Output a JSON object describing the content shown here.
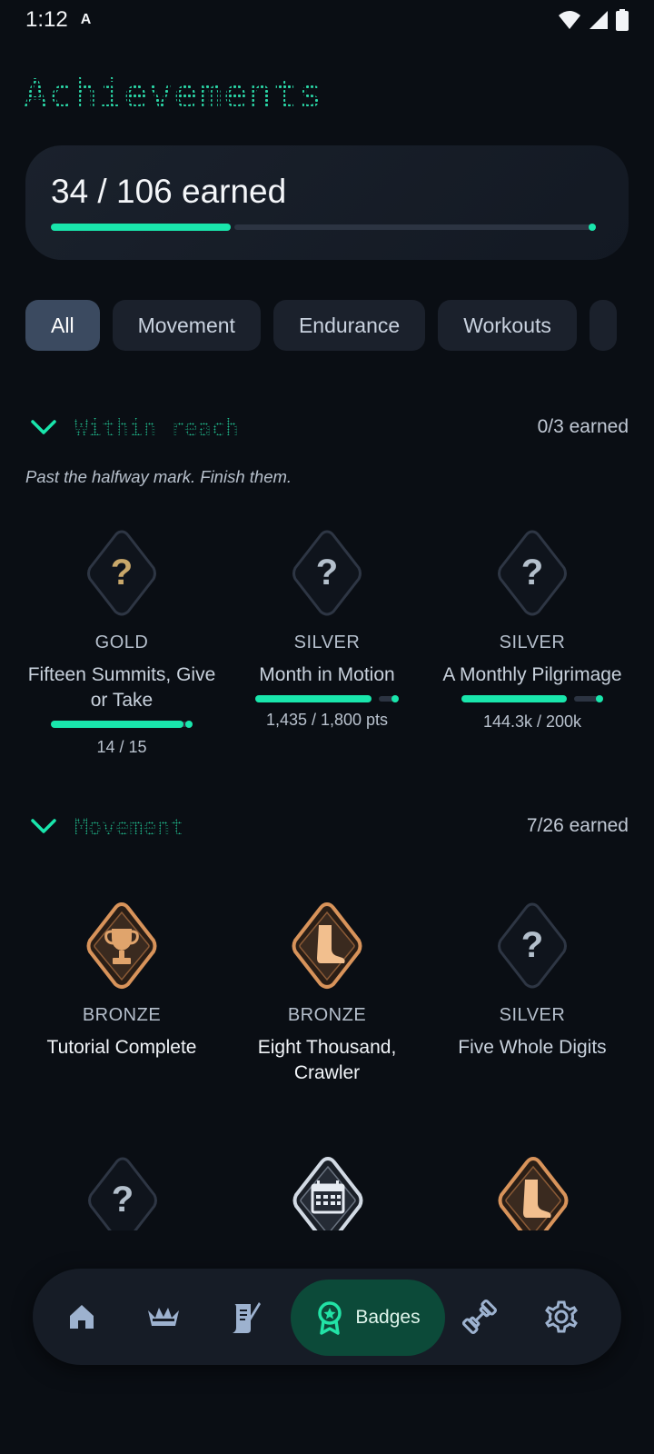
{
  "status_bar": {
    "time": "1:12",
    "indicator": "A"
  },
  "page": {
    "title": "Achievements"
  },
  "summary": {
    "text": "34 / 106 earned",
    "progress": 0.32
  },
  "filters": {
    "selected": "All",
    "chips": [
      "All",
      "Movement",
      "Endurance",
      "Workouts"
    ]
  },
  "sections": {
    "within_reach": {
      "title": "Within reach",
      "count": "0/3 earned",
      "subtitle": "Past the halfway mark. Finish them.",
      "badges": [
        {
          "tier": "GOLD",
          "name": "Fifteen Summits, Give or Take",
          "progress_text": "14 / 15",
          "progress": 0.93,
          "icon": "question-icon",
          "locked": true
        },
        {
          "tier": "SILVER",
          "name": "Month in Motion",
          "progress_text": "1,435 / 1,800 pts",
          "progress": 0.8,
          "icon": "question-icon",
          "locked": true
        },
        {
          "tier": "SILVER",
          "name": "A Monthly Pilgrimage",
          "progress_text": "144.3k / 200k",
          "progress": 0.72,
          "icon": "question-icon",
          "locked": true
        }
      ]
    },
    "movement": {
      "title": "Movement",
      "count": "7/26 earned",
      "badges": [
        {
          "tier": "BRONZE",
          "name": "Tutorial Complete",
          "icon": "trophy-icon",
          "locked": false
        },
        {
          "tier": "BRONZE",
          "name": "Eight Thousand, Crawler",
          "icon": "foot-icon",
          "locked": false
        },
        {
          "tier": "SILVER",
          "name": "Five Whole Digits",
          "icon": "question-icon",
          "locked": true
        }
      ],
      "next_row_icons": [
        "question-icon",
        "calendar-icon",
        "foot-icon"
      ]
    }
  },
  "nav": {
    "active_label": "Badges",
    "items": [
      "home-icon",
      "crown-icon",
      "scroll-icon",
      "badge-icon",
      "dumbbell-icon",
      "gear-icon"
    ]
  },
  "colors": {
    "accent": "#19e6ac",
    "gold_question": "#c9a86a",
    "bronze": "#c98a55",
    "silver": "#b4c0cc",
    "locked_outline": "#2e3644"
  }
}
